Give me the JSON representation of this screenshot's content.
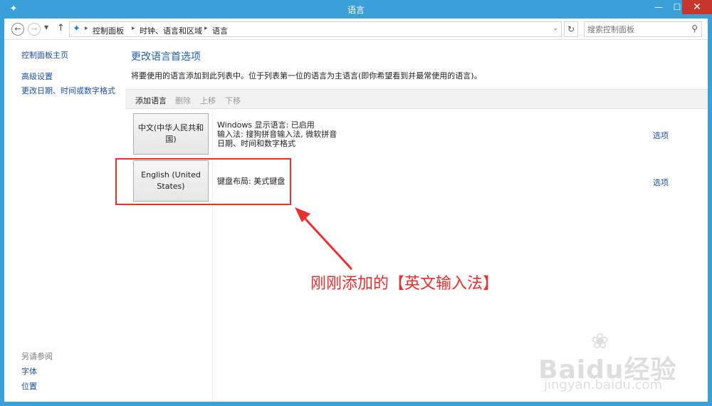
{
  "window": {
    "title": "语言"
  },
  "address": {
    "crumbs": [
      "控制面板",
      "时钟、语言和区域",
      "语言"
    ],
    "search_placeholder": "搜索控制面板"
  },
  "sidebar": {
    "home": "控制面板主页",
    "links": [
      "高级设置",
      "更改日期、时间或数字格式"
    ],
    "see_also_heading": "另请参阅",
    "see_also": [
      "字体",
      "位置"
    ]
  },
  "main": {
    "heading": "更改语言首选项",
    "description": "将要使用的语言添加到此列表中。位于列表第一位的语言为主语言(即你希望看到并最常使用的语言)。",
    "toolbar": {
      "add": "添加语言",
      "remove": "删除",
      "up": "上移",
      "down": "下移"
    },
    "languages": [
      {
        "name": "中文(中华人民共和国)",
        "lines": [
          "Windows 显示语言: 已启用",
          "输入法: 搜狗拼音输入法, 微软拼音",
          "日期、时间和数字格式"
        ],
        "options": "选项"
      },
      {
        "name": "English (United States)",
        "lines": [
          "键盘布局: 美式键盘"
        ],
        "options": "选项"
      }
    ]
  },
  "annotation": {
    "text": "刚刚添加的【英文输入法】",
    "color": "#e8302e"
  },
  "watermark": {
    "brand": "Baidu经验",
    "url": "jingyan.baidu.com"
  },
  "colors": {
    "titlebar": "#3aa0d8",
    "link": "#1c4fa8",
    "heading": "#1f5fb4",
    "close": "#c7362b"
  }
}
